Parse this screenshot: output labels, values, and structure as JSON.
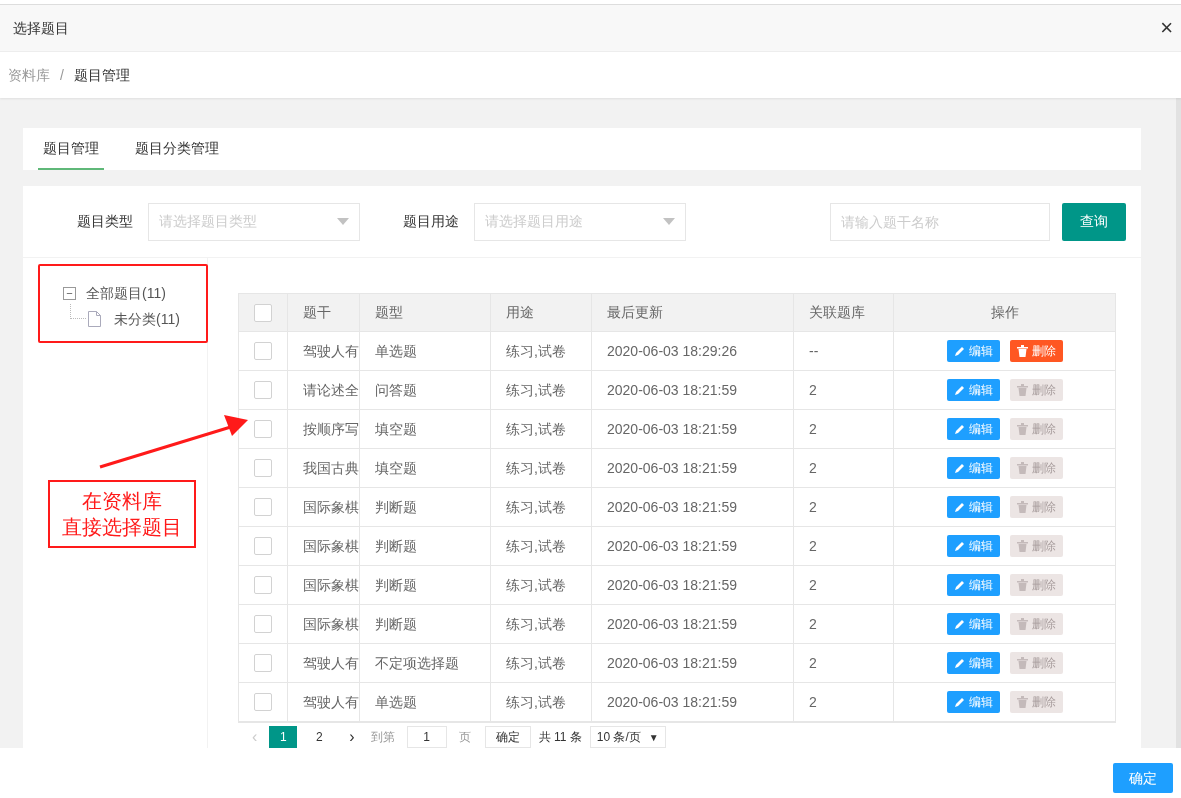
{
  "dialog": {
    "title": "选择题目",
    "close": "×"
  },
  "breadcrumb": [
    "资料库",
    "/",
    "题目管理"
  ],
  "tabs": [
    {
      "label": "题目管理",
      "selected": true
    },
    {
      "label": "题目分类管理",
      "selected": false
    }
  ],
  "filters": {
    "type_label": "题目类型",
    "type_placeholder": "请选择题目类型",
    "use_label": "题目用途",
    "use_placeholder": "请选择题目用途",
    "search_placeholder": "请输入题干名称",
    "query_button": "查询"
  },
  "tree": [
    {
      "label": "全部题目(11)",
      "expander": "−",
      "expanded": true,
      "children": [
        {
          "label": "未分类(11)"
        }
      ]
    }
  ],
  "table": {
    "header_checked": false,
    "columns": [
      "题干",
      "题型",
      "用途",
      "最后更新",
      "关联题库",
      "操作"
    ],
    "rows": [
      {
        "checked": false,
        "cells": [
          "驾驶人有",
          "单选题",
          "练习,试卷",
          "2020-06-03 18:29:26",
          "--"
        ],
        "edit": "编辑",
        "delete": "删除",
        "delete_disabled": false
      },
      {
        "checked": false,
        "cells": [
          "请论述全",
          "问答题",
          "练习,试卷",
          "2020-06-03 18:21:59",
          "2"
        ],
        "edit": "编辑",
        "delete": "删除",
        "delete_disabled": true
      },
      {
        "checked": false,
        "cells": [
          "按顺序写",
          "填空题",
          "练习,试卷",
          "2020-06-03 18:21:59",
          "2"
        ],
        "edit": "编辑",
        "delete": "删除",
        "delete_disabled": true
      },
      {
        "checked": false,
        "cells": [
          "我国古典",
          "填空题",
          "练习,试卷",
          "2020-06-03 18:21:59",
          "2"
        ],
        "edit": "编辑",
        "delete": "删除",
        "delete_disabled": true
      },
      {
        "checked": false,
        "cells": [
          "国际象棋",
          "判断题",
          "练习,试卷",
          "2020-06-03 18:21:59",
          "2"
        ],
        "edit": "编辑",
        "delete": "删除",
        "delete_disabled": true
      },
      {
        "checked": false,
        "cells": [
          "国际象棋",
          "判断题",
          "练习,试卷",
          "2020-06-03 18:21:59",
          "2"
        ],
        "edit": "编辑",
        "delete": "删除",
        "delete_disabled": true
      },
      {
        "checked": false,
        "cells": [
          "国际象棋",
          "判断题",
          "练习,试卷",
          "2020-06-03 18:21:59",
          "2"
        ],
        "edit": "编辑",
        "delete": "删除",
        "delete_disabled": true
      },
      {
        "checked": false,
        "cells": [
          "国际象棋",
          "判断题",
          "练习,试卷",
          "2020-06-03 18:21:59",
          "2"
        ],
        "edit": "编辑",
        "delete": "删除",
        "delete_disabled": true
      },
      {
        "checked": false,
        "cells": [
          "驾驶人有",
          "不定项选择题",
          "练习,试卷",
          "2020-06-03 18:21:59",
          "2"
        ],
        "edit": "编辑",
        "delete": "删除",
        "delete_disabled": true
      },
      {
        "checked": false,
        "cells": [
          "驾驶人有",
          "单选题",
          "练习,试卷",
          "2020-06-03 18:21:59",
          "2"
        ],
        "edit": "编辑",
        "delete": "删除",
        "delete_disabled": true
      }
    ]
  },
  "pagination": {
    "prev": "‹",
    "pages": [
      {
        "label": "1",
        "selected": true
      },
      {
        "label": "2",
        "selected": false
      }
    ],
    "next": "›",
    "goto_label": "到第",
    "goto_value": "1",
    "page_unit": "页",
    "confirm": "确定",
    "total": "共 11 条",
    "page_size": "10 条/页",
    "page_size_caret": "▼"
  },
  "annotation": {
    "text_lines": [
      "在资料库",
      "直接选择题目"
    ]
  },
  "footer": {
    "confirm_button": "确定"
  }
}
